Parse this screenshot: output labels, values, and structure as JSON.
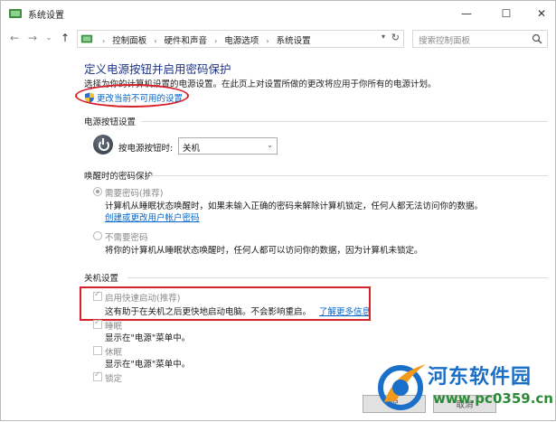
{
  "window": {
    "title": "系统设置",
    "minimize_glyph": "—",
    "maximize_glyph": "☐",
    "close_glyph": "✕"
  },
  "nav": {
    "back_glyph": "←",
    "forward_glyph": "→",
    "recent_glyph": "⌄",
    "up_glyph": "↑",
    "breadcrumbs": [
      "控制面板",
      "硬件和声音",
      "电源选项",
      "系统设置"
    ],
    "search_placeholder": "搜索控制面板"
  },
  "main": {
    "heading": "定义电源按钮并启用密码保护",
    "description": "选择为你的计算机设置的电源设置。在此页上对设置所做的更改将应用于你所有的电源计划。",
    "uac_link": "更改当前不可用的设置",
    "power_button": {
      "group_label": "电源按钮设置",
      "field_label": "按电源按钮时:",
      "selected_value": "关机"
    },
    "wake_password": {
      "group_label": "唤醒时的密码保护",
      "option1_title": "需要密码(推荐)",
      "option1_desc": "计算机从睡眠状态唤醒时，如果未输入正确的密码来解除计算机锁定，任何人都无法访问你的数据。",
      "option1_link": "创建或更改用户帐户密码",
      "option2_title": "不需要密码",
      "option2_desc": "将你的计算机从睡眠状态唤醒时，任何人都可以访问你的数据，因为计算机未锁定。"
    },
    "shutdown": {
      "group_label": "关机设置",
      "fast_startup_title": "启用快速启动(推荐)",
      "fast_startup_desc": "这有助于在关机之后更快地启动电脑。不会影响重启。",
      "fast_startup_link": "了解更多信息",
      "sleep_title": "睡眠",
      "sleep_desc": "显示在\"电源\"菜单中。",
      "hibernate_title": "休眠",
      "hibernate_desc": "显示在\"电源\"菜单中。",
      "lock_title": "锁定"
    },
    "buttons": {
      "save": "保",
      "cancel": "取消"
    }
  },
  "watermark": {
    "title": "河东软件园",
    "url": "www.pc0359.cn"
  },
  "colors": {
    "heading": "#1e3287",
    "link": "#0066cc",
    "highlight": "#d6202a"
  }
}
